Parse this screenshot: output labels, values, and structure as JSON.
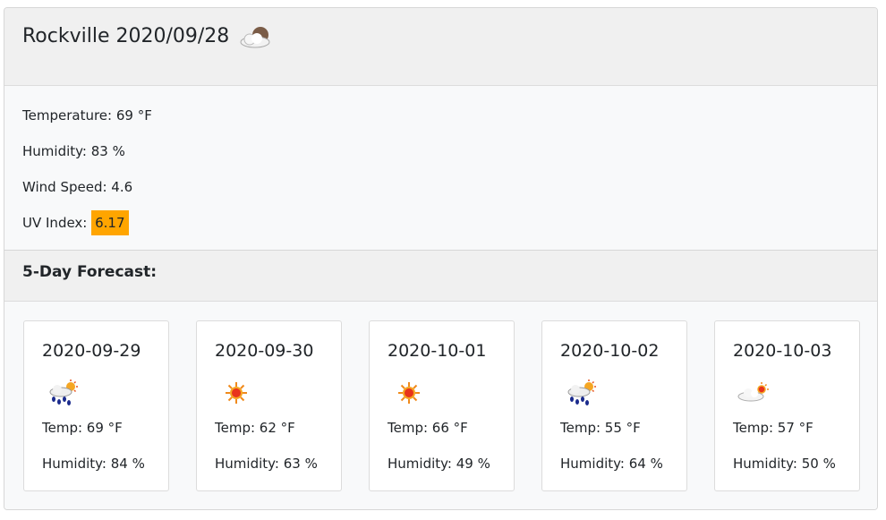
{
  "current": {
    "title": "Rockville 2020/09/28",
    "icon": "cloudy-night-icon",
    "temperature": "Temperature: 69 °F",
    "humidity": "Humidity: 83 %",
    "wind_speed": "Wind Speed: 4.6",
    "uv_label": "UV Index: ",
    "uv_value": "6.17",
    "uv_color": "#ffa500"
  },
  "forecast": {
    "title": "5-Day Forecast:",
    "days": [
      {
        "date": "2020-09-29",
        "icon": "rain-sun-icon",
        "temp": "Temp: 69 °F",
        "humidity": "Humidity: 84 %"
      },
      {
        "date": "2020-09-30",
        "icon": "sun-icon",
        "temp": "Temp: 62 °F",
        "humidity": "Humidity: 63 %"
      },
      {
        "date": "2020-10-01",
        "icon": "sun-icon",
        "temp": "Temp: 66 °F",
        "humidity": "Humidity: 49 %"
      },
      {
        "date": "2020-10-02",
        "icon": "rain-sun-icon",
        "temp": "Temp: 55 °F",
        "humidity": "Humidity: 64 %"
      },
      {
        "date": "2020-10-03",
        "icon": "cloud-sun-icon",
        "temp": "Temp: 57 °F",
        "humidity": "Humidity: 50 %"
      }
    ]
  }
}
